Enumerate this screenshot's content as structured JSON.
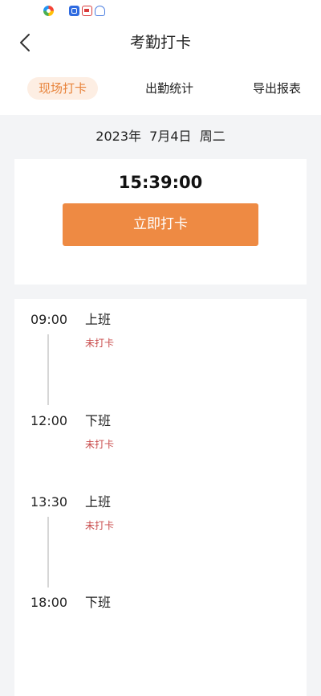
{
  "status_bar": {
    "icons": [
      "chrome-like-app-icon",
      "blue-app-icon",
      "red-app-icon",
      "blue-bell-app-icon"
    ]
  },
  "header": {
    "title": "考勤打卡",
    "back_icon": "chevron-left-icon"
  },
  "tabs": [
    {
      "label": "现场打卡",
      "active": true
    },
    {
      "label": "出勤统计",
      "active": false
    },
    {
      "label": "导出报表",
      "active": false
    }
  ],
  "date": {
    "text": "2023年  7月4日  周二"
  },
  "clock": {
    "time": "15:39:00",
    "button_label": "立即打卡"
  },
  "schedule": [
    {
      "time": "09:00",
      "label": "上班",
      "status": "未打卡"
    },
    {
      "time": "12:00",
      "label": "下班",
      "status": "未打卡"
    },
    {
      "time": "13:30",
      "label": "上班",
      "status": "未打卡"
    },
    {
      "time": "18:00",
      "label": "下班",
      "status": ""
    }
  ],
  "colors": {
    "accent": "#ee8a43",
    "tab_active_bg": "#fdeee3",
    "tab_active_text": "#e8833a",
    "status_red": "#c84a4a",
    "page_bg": "#f3f4f6"
  }
}
